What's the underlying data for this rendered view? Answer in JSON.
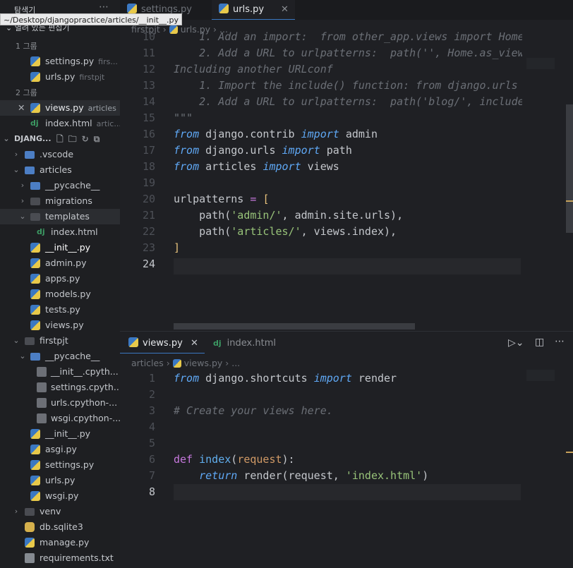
{
  "tooltip": "~/Desktop/djangopractice/articles/__init__.py",
  "sidebar": {
    "explorer_title": "탐색기",
    "open_editors": "열려 있는 편집기",
    "group1": "1 그룹",
    "group2": "2 그룹",
    "group1_items": [
      {
        "name": "settings.py",
        "hint": "firs..."
      },
      {
        "name": "urls.py",
        "hint": "firstpjt"
      }
    ],
    "group2_items": [
      {
        "name": "views.py",
        "hint": "articles"
      },
      {
        "name": "index.html",
        "hint": "artic..."
      }
    ],
    "workspace": "DJANG...",
    "tree": [
      ".vscode",
      "articles",
      "__pycache__",
      "migrations",
      "templates",
      "index.html",
      "__init__.py",
      "admin.py",
      "apps.py",
      "models.py",
      "tests.py",
      "views.py",
      "firstpjt",
      "__pycache__",
      "__init__.cpyth...",
      "settings.cpyth...",
      "urls.cpython-...",
      "wsgi.cpython-...",
      "__init__.py",
      "asgi.py",
      "settings.py",
      "urls.py",
      "wsgi.py",
      "venv",
      "db.sqlite3",
      "manage.py",
      "requirements.txt"
    ]
  },
  "top_editor": {
    "tabs": [
      {
        "label": "settings.py"
      },
      {
        "label": "urls.py"
      }
    ],
    "breadcrumb": [
      "firstpjt",
      "urls.py",
      "..."
    ],
    "line_numbers": [
      "10",
      "11",
      "12",
      "13",
      "14",
      "15",
      "16",
      "17",
      "18",
      "19",
      "20",
      "21",
      "22",
      "23",
      "24"
    ],
    "lines": [
      "    1. Add an import:  from other_app.views import Home",
      "    2. Add a URL to urlpatterns:  path('', Home.as_view",
      "Including another URLconf",
      "    1. Import the include() function: from django.urls",
      "    2. Add a URL to urlpatterns:  path('blog/', include",
      "\"\"\"",
      "from django.contrib import admin",
      "from django.urls import path",
      "from articles import views",
      "",
      "urlpatterns = [",
      "    path('admin/', admin.site.urls),",
      "    path('articles/', views.index),",
      "]",
      ""
    ]
  },
  "bottom_editor": {
    "tabs": [
      {
        "label": "views.py"
      },
      {
        "label": "index.html"
      }
    ],
    "breadcrumb": [
      "articles",
      "views.py",
      "..."
    ],
    "line_numbers": [
      "1",
      "2",
      "3",
      "4",
      "5",
      "6",
      "7",
      "8"
    ],
    "lines": [
      "from django.shortcuts import render",
      "",
      "# Create your views here.",
      "",
      "",
      "def index(request):",
      "    return render(request, 'index.html')",
      ""
    ]
  },
  "colors": {
    "accent": "#3b78c2",
    "background": "#1f2024",
    "sidebar": "#1e1f22"
  }
}
